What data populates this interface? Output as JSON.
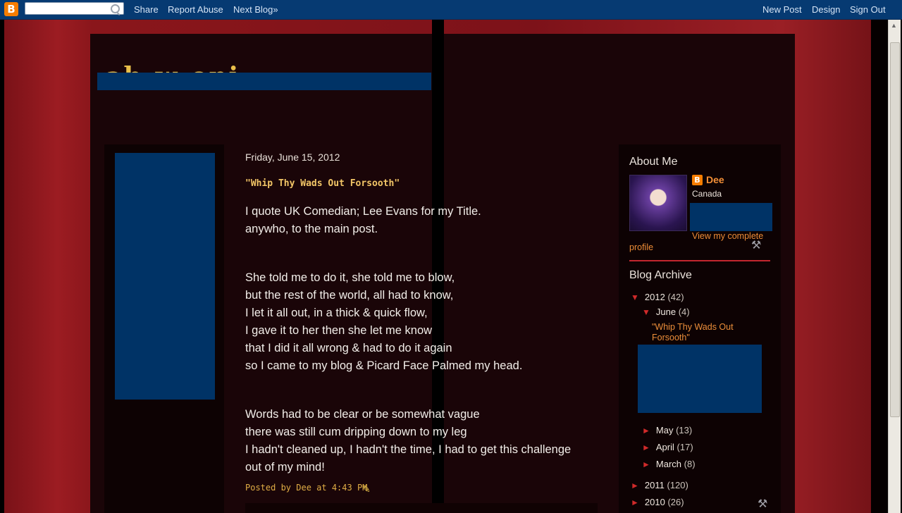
{
  "navbar": {
    "search_placeholder": "",
    "links": [
      "Share",
      "Report Abuse",
      "Next Blog»"
    ],
    "right_links": [
      "New Post",
      "Design",
      "Sign Out"
    ]
  },
  "header": {
    "title": "ah-w-oni"
  },
  "post": {
    "date": "Friday, June 15, 2012",
    "title": "\"Whip Thy Wads Out Forsooth\"",
    "lines": [
      "I quote UK Comedian; Lee Evans for my Title.",
      "anywho, to the main post.",
      "She told me to do it, she told me to blow,",
      "but the rest of the world, all had to know,",
      "I let it all out, in a thick & quick flow,",
      "I gave it to her then she let me know",
      "that I did it all wrong & had to do it again",
      "so I came to my blog & Picard Face Palmed my head.",
      "Words had to be clear or be somewhat vague",
      "there was still cum dripping down to my leg",
      "I hadn't cleaned up, I hadn't the time, I had to get this challenge",
      "out of my mind!"
    ],
    "footer": "Posted by Dee at 4:43 PM"
  },
  "sidebar": {
    "about_title": "About Me",
    "name": "Dee",
    "location": "Canada",
    "profile_link_1": "View my complete",
    "profile_link_2": "profile",
    "archive_title": "Blog Archive",
    "archive": [
      {
        "label": "2012",
        "count": "(42)",
        "expanded": true
      },
      {
        "label": "June",
        "count": "(4)",
        "expanded": true
      },
      {
        "label": "May",
        "count": "(13)"
      },
      {
        "label": "April",
        "count": "(17)"
      },
      {
        "label": "March",
        "count": "(8)"
      },
      {
        "label": "2011",
        "count": "(120)"
      },
      {
        "label": "2010",
        "count": "(26)"
      }
    ],
    "current_post": "\"Whip Thy Wads Out Forsooth\""
  },
  "colors": {
    "navbar": "#063a72",
    "accent": "#f57d00",
    "title": "#f3c667",
    "link": "#ed8c37",
    "overlay": "#003366"
  }
}
